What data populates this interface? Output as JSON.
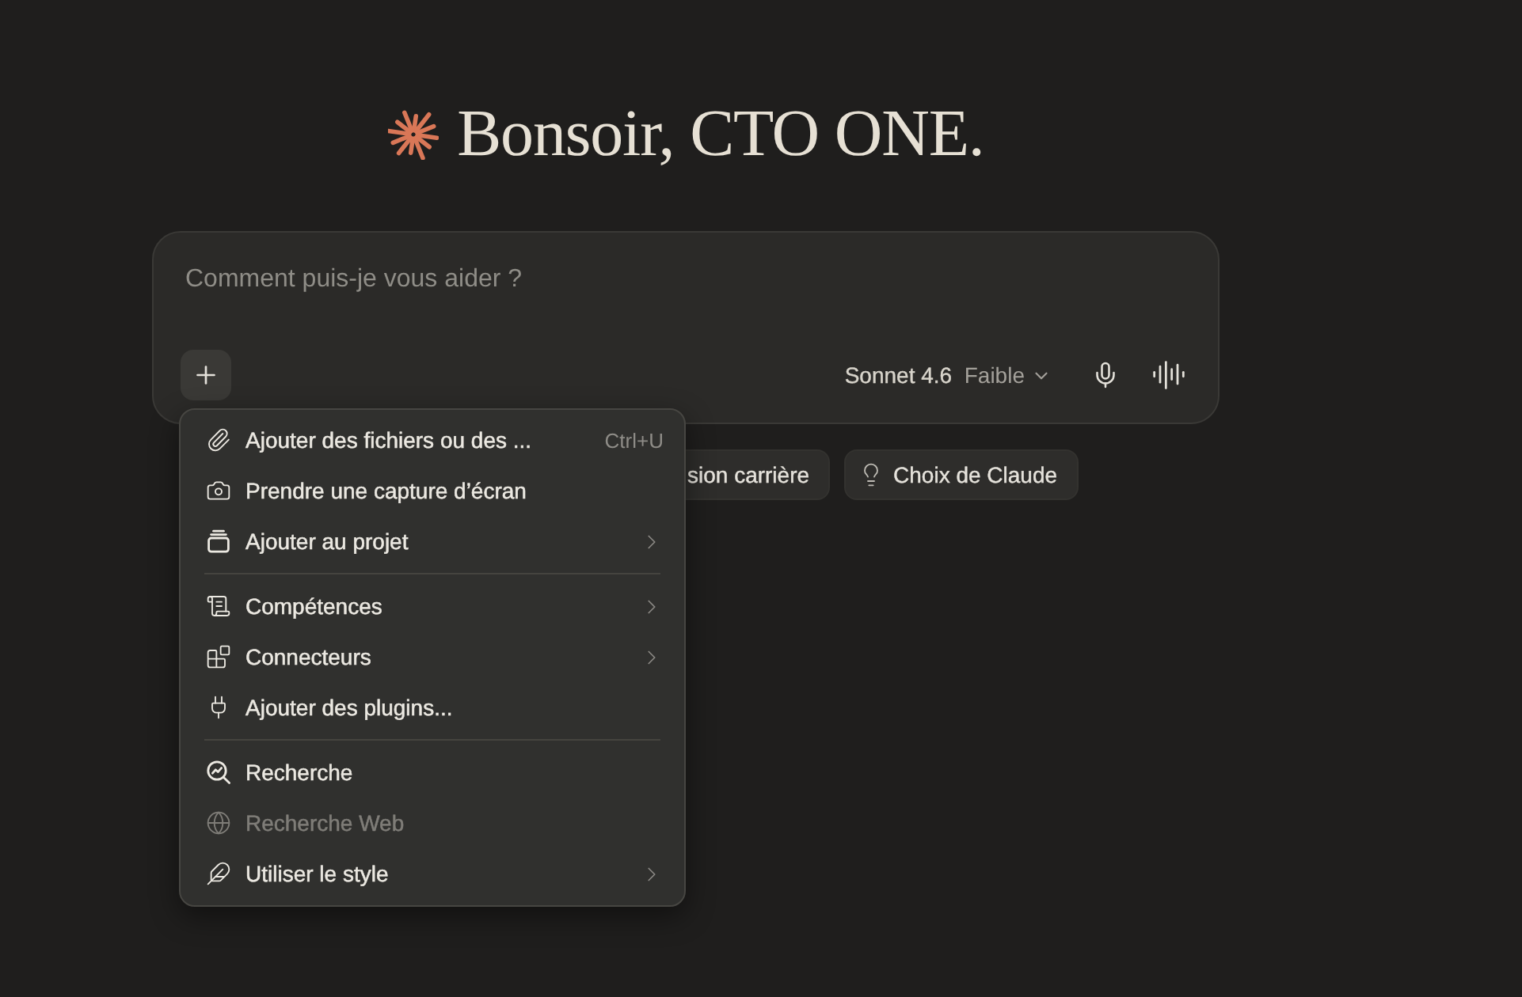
{
  "greeting": {
    "text": "Bonsoir, CTO ONE."
  },
  "composer": {
    "placeholder": "Comment puis-je vous aider ?",
    "model": "Sonnet 4.6",
    "effort": "Faible"
  },
  "suggestions": [
    {
      "kind": "clipped",
      "label": "sion carrière"
    },
    {
      "kind": "full",
      "label": "Choix de Claude"
    }
  ],
  "menu": {
    "sections": [
      {
        "items": [
          {
            "label": "Ajouter des fichiers ou des ...",
            "shortcut": "Ctrl+U",
            "submenu": false,
            "disabled": false
          },
          {
            "label": "Prendre une capture d’écran",
            "submenu": false,
            "disabled": false
          },
          {
            "label": "Ajouter au projet",
            "submenu": true,
            "disabled": false
          }
        ]
      },
      {
        "items": [
          {
            "label": "Compétences",
            "submenu": true,
            "disabled": false
          },
          {
            "label": "Connecteurs",
            "submenu": true,
            "disabled": false
          },
          {
            "label": "Ajouter des plugins...",
            "submenu": false,
            "disabled": false
          }
        ]
      },
      {
        "items": [
          {
            "label": "Recherche",
            "submenu": false,
            "disabled": false
          },
          {
            "label": "Recherche Web",
            "submenu": false,
            "disabled": true
          },
          {
            "label": "Utiliser le style",
            "submenu": true,
            "disabled": false
          }
        ]
      }
    ]
  }
}
